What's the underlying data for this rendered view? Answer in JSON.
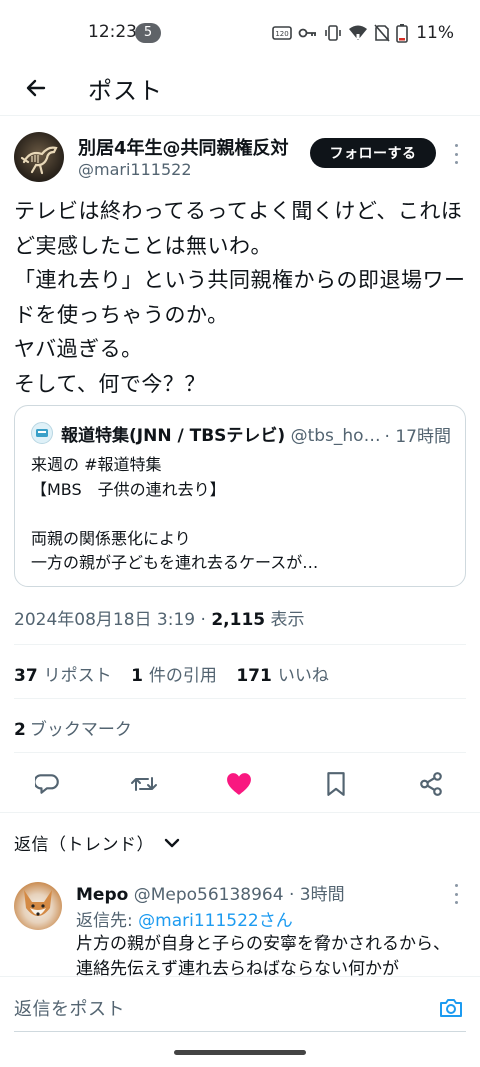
{
  "status_bar": {
    "time": "12:23",
    "notification_count": "5",
    "battery": "11%"
  },
  "header": {
    "title": "ポスト"
  },
  "post": {
    "author_name": "別居4年生@共同親権反対",
    "author_handle": "@mari111522",
    "follow_label": "フォローする",
    "text": "テレビは終わってるってよく聞くけど、これほど実感したことは無いわ。\n「連れ去り」という共同親権からの即退場ワードを使っちゃうのか。\nヤバ過ぎる。\nそして、何で今？？",
    "datetime": "2024年08月18日 3:19",
    "views_count": "2,115",
    "views_label": "表示",
    "reposts_count": "37",
    "reposts_label": "リポスト",
    "quotes_count": "1",
    "quotes_label": "件の引用",
    "likes_count": "171",
    "likes_label": "いいね",
    "bookmarks_count": "2",
    "bookmarks_label": "ブックマーク"
  },
  "quote": {
    "name": "報道特集(JNN / TBSテレビ)",
    "handle": "@tbs_ho…",
    "time": "· 17時間",
    "text": "来週の #報道特集\n【MBS　子供の連れ去り】\n\n両親の関係悪化により\n一方の親が子どもを連れ去るケースが…"
  },
  "reply_sort": {
    "label": "返信（トレンド）"
  },
  "reply": {
    "name": "Mepo",
    "handle": "@Mepo56138964",
    "time": "· 3時間",
    "reply_to_prefix": "返信先: ",
    "reply_to_mention": "@mari111522さん",
    "text": "片方の親が自身と子らの安寧を脅かされるから、連絡先伝えず連れ去らねばならない何かが"
  },
  "composer": {
    "placeholder": "返信をポスト"
  },
  "colors": {
    "accent": "#1d9bf0",
    "like": "#f91880",
    "text": "#0f1419",
    "muted": "#536471"
  }
}
